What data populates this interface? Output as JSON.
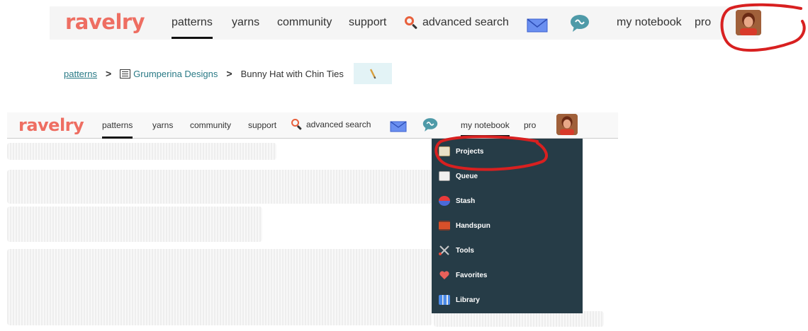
{
  "top_nav": {
    "logo": "ravelry",
    "items": [
      "patterns",
      "yarns",
      "community",
      "support"
    ],
    "search_label": "advanced search",
    "notebook": "my notebook",
    "pro": "pro"
  },
  "breadcrumb": {
    "root": "patterns",
    "designer": "Grumperina Designs",
    "pattern": "Bunny Hat with Chin Ties"
  },
  "second_nav": {
    "logo": "ravelry",
    "items": [
      "patterns",
      "yarns",
      "community",
      "support"
    ],
    "search_label": "advanced search",
    "notebook": "my notebook",
    "pro": "pro"
  },
  "notebook_menu": {
    "items": [
      "Projects",
      "Queue",
      "Stash",
      "Handspun",
      "Tools",
      "Favorites",
      "Library"
    ]
  },
  "colors": {
    "logo": "#ee6e62",
    "menu_bg": "#263c47",
    "link": "#2a7a86",
    "marker": "#d82020"
  }
}
